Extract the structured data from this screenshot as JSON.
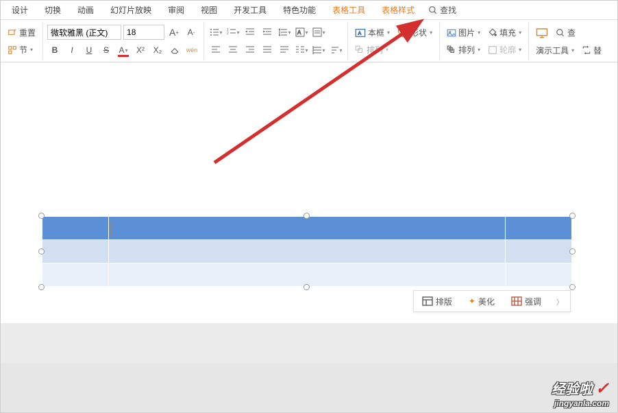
{
  "menu": {
    "items": [
      "设计",
      "切换",
      "动画",
      "幻灯片放映",
      "审阅",
      "视图",
      "开发工具",
      "特色功能"
    ],
    "table_tools": "表格工具",
    "table_style": "表格样式",
    "search": "查找"
  },
  "ribbon": {
    "reset": "重置",
    "section": "节",
    "font_name": "微软雅黑 (正文)",
    "font_size": "18",
    "textbox": "本框",
    "shape": "形状",
    "picture": "图片",
    "arrange": "排列",
    "fill": "填充",
    "outline": "轮廓",
    "present_tools": "演示工具",
    "find": "查",
    "replace": "替"
  },
  "float_toolbar": {
    "layout": "排版",
    "beautify": "美化",
    "emphasize": "强调"
  },
  "watermark": {
    "title": "经验啦",
    "url": "jingyanla.com"
  },
  "chart_data": {
    "type": "table",
    "rows": 3,
    "cols": 3,
    "header_row": true,
    "cells": [
      [
        "",
        "",
        ""
      ],
      [
        "",
        "",
        ""
      ],
      [
        "",
        "",
        ""
      ]
    ]
  }
}
